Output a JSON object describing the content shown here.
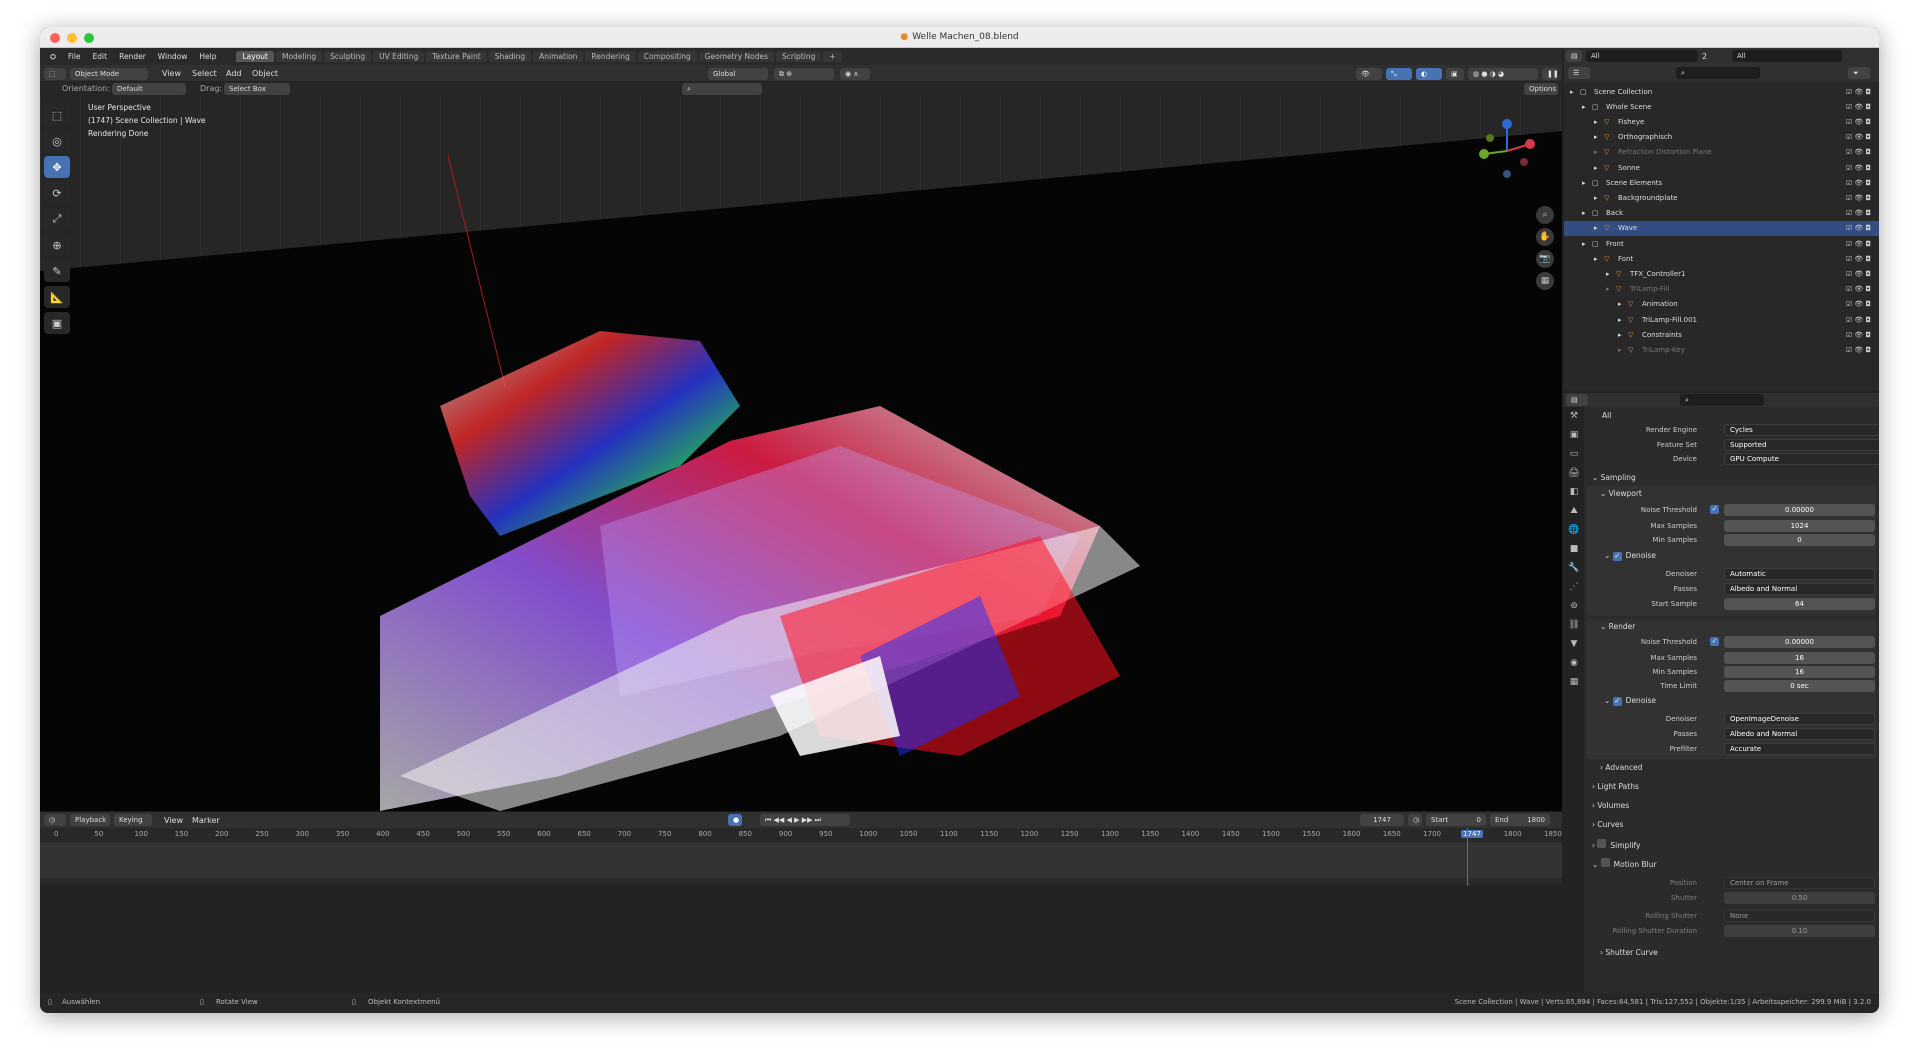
{
  "window": {
    "title": "Welle Machen_08.blend"
  },
  "menus": [
    "File",
    "Edit",
    "Render",
    "Window",
    "Help"
  ],
  "workspaces": [
    "Layout",
    "Modeling",
    "Sculpting",
    "UV Editing",
    "Texture Paint",
    "Shading",
    "Animation",
    "Rendering",
    "Compositing",
    "Geometry Nodes",
    "Scripting"
  ],
  "header": {
    "mode": "Object Mode",
    "view": "View",
    "select": "Select",
    "add": "Add",
    "object": "Object",
    "orientation": "Global",
    "options": "Options"
  },
  "header2": {
    "orientation_label": "Orientation:",
    "orientation_value": "Default",
    "drag_label": "Drag:",
    "drag_value": "Select Box"
  },
  "viewport": {
    "line1": "User Perspective",
    "line2": "(1747) Scene Collection | Wave",
    "line3": "Rendering Done"
  },
  "scene_selector": {
    "view_layer": "All",
    "count": "2",
    "right": "All"
  },
  "outliner": {
    "rows": [
      {
        "label": "Scene Collection",
        "indent": 0
      },
      {
        "label": "Whole Scene",
        "indent": 1
      },
      {
        "label": "Fisheye",
        "indent": 2
      },
      {
        "label": "Orthographisch",
        "indent": 2
      },
      {
        "label": "Refraction Distortion Plane",
        "indent": 2,
        "dim": true
      },
      {
        "label": "Sonne",
        "indent": 2
      },
      {
        "label": "Scene Elements",
        "indent": 1
      },
      {
        "label": "Backgroundplate",
        "indent": 2
      },
      {
        "label": "Back",
        "indent": 1
      },
      {
        "label": "Wave",
        "indent": 2,
        "selected": true
      },
      {
        "label": "Front",
        "indent": 1
      },
      {
        "label": "Font",
        "indent": 2
      },
      {
        "label": "TFX_Controller1",
        "indent": 3
      },
      {
        "label": "TriLamp-Fill",
        "indent": 3,
        "dim": true
      },
      {
        "label": "Animation",
        "indent": 4
      },
      {
        "label": "TriLamp-Fill.001",
        "indent": 4
      },
      {
        "label": "Constraints",
        "indent": 4
      },
      {
        "label": "TriLamp-Key",
        "indent": 4,
        "dim": true
      }
    ]
  },
  "properties": {
    "context": "All",
    "render_engine_label": "Render Engine",
    "render_engine": "Cycles",
    "feature_set_label": "Feature Set",
    "feature_set": "Supported",
    "device_label": "Device",
    "device": "GPU Compute",
    "sampling": "Sampling",
    "viewport": "Viewport",
    "noise_threshold_label": "Noise Threshold",
    "vp_noise_threshold": "0.00000",
    "max_samples_label": "Max Samples",
    "vp_max_samples": "1024",
    "min_samples_label": "Min Samples",
    "vp_min_samples": "0",
    "denoise": "Denoise",
    "denoiser_label": "Denoiser",
    "vp_denoiser": "Automatic",
    "passes_label": "Passes",
    "vp_passes": "Albedo and Normal",
    "start_sample_label": "Start Sample",
    "vp_start_sample": "64",
    "render": "Render",
    "r_noise_threshold": "0.00000",
    "r_max_samples": "16",
    "r_min_samples": "16",
    "time_limit_label": "Time Limit",
    "r_time_limit": "0 sec",
    "r_denoiser": "OpenImageDenoise",
    "r_passes": "Albedo and Normal",
    "prefilter_label": "Prefilter",
    "r_prefilter": "Accurate",
    "advanced": "Advanced",
    "light_paths": "Light Paths",
    "volumes": "Volumes",
    "curves": "Curves",
    "simplify": "Simplify",
    "motion_blur": "Motion Blur",
    "position_label": "Position",
    "position": "Center on Frame",
    "shutter_label": "Shutter",
    "shutter": "0.50",
    "rolling_shutter_label": "Rolling Shutter",
    "rolling_shutter": "None",
    "rolling_duration_label": "Rolling Shutter Duration",
    "rolling_duration": "0.10",
    "shutter_curve": "Shutter Curve"
  },
  "timeline": {
    "playback": "Playback",
    "keying": "Keying",
    "view": "View",
    "marker": "Marker",
    "current": "1747",
    "start_label": "Start",
    "start": "0",
    "end_label": "End",
    "end": "1800",
    "ticks": [
      "0",
      "50",
      "100",
      "150",
      "200",
      "250",
      "300",
      "350",
      "400",
      "450",
      "500",
      "550",
      "600",
      "650",
      "700",
      "750",
      "800",
      "850",
      "900",
      "950",
      "1000",
      "1050",
      "1100",
      "1150",
      "1200",
      "1250",
      "1300",
      "1350",
      "1400",
      "1450",
      "1500",
      "1550",
      "1600",
      "1650",
      "1700",
      "1747",
      "1800",
      "1850"
    ],
    "playhead_frame": 1747
  },
  "status": {
    "left1": "Auswählen",
    "left2": "Rotate View",
    "left3": "Objekt Kontextmenü",
    "right": "Scene Collection | Wave | Verts:65,894 | Faces:64,581 | Tris:127,552 | Objekte:1/35 | Arbeitsspeicher: 299.9 MiB | 3.2.0"
  },
  "colors": {
    "accent": "#4772b3",
    "selected_row": "#334d80",
    "bg": "#232323"
  }
}
